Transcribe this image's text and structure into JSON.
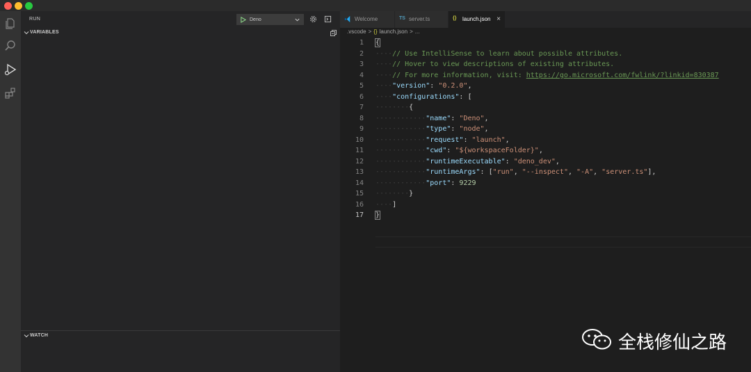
{
  "window": {
    "traffic_lights": [
      "close",
      "minimize",
      "maximize"
    ]
  },
  "activity_bar": {
    "icons": [
      "files-icon",
      "search-icon",
      "run-debug-icon",
      "extensions-icon"
    ]
  },
  "sidebar": {
    "title": "RUN",
    "config_select": "Deno",
    "variables_label": "VARIABLES",
    "watch_label": "WATCH"
  },
  "tabs": [
    {
      "label": "Welcome",
      "icon": "vscode-icon",
      "active": false
    },
    {
      "label": "server.ts",
      "icon_text": "TS",
      "active": false
    },
    {
      "label": "launch.json",
      "icon_text": "{}",
      "active": true,
      "close": "×"
    }
  ],
  "breadcrumb": {
    "folder": ".vscode",
    "sep": ">",
    "file_icon": "{}",
    "file": "launch.json",
    "more": "..."
  },
  "code": {
    "line_numbers": [
      "1",
      "2",
      "3",
      "4",
      "5",
      "6",
      "7",
      "8",
      "9",
      "10",
      "11",
      "12",
      "13",
      "14",
      "15",
      "16",
      "17"
    ],
    "lines": {
      "l1": "{",
      "l2": "// Use IntelliSense to learn about possible attributes.",
      "l3": "// Hover to view descriptions of existing attributes.",
      "l4_text": "// For more information, visit: ",
      "l4_link": "https://go.microsoft.com/fwlink/?linkid=830387",
      "l5_key": "\"version\"",
      "l5_val": "\"0.2.0\"",
      "l6_key": "\"configurations\"",
      "l6_rest": ": [",
      "l7": "{",
      "l8_key": "\"name\"",
      "l8_val": "\"Deno\"",
      "l9_key": "\"type\"",
      "l9_val": "\"node\"",
      "l10_key": "\"request\"",
      "l10_val": "\"launch\"",
      "l11_key": "\"cwd\"",
      "l11_val": "\"${workspaceFolder}\"",
      "l12_key": "\"runtimeExecutable\"",
      "l12_val": "\"deno_dev\"",
      "l13_key": "\"runtimeArgs\"",
      "l13_v1": "\"run\"",
      "l13_v2": "\"--inspect\"",
      "l13_v3": "\"-A\"",
      "l13_v4": "\"server.ts\"",
      "l14_key": "\"port\"",
      "l14_val": "9229",
      "l15": "}",
      "l16": "]",
      "l17": "}"
    }
  },
  "watermark": {
    "text": "全栈修仙之路",
    "icon": "wechat-icon"
  },
  "colors": {
    "comment": "#6a9955",
    "key": "#9cdcfe",
    "string": "#ce9178",
    "number": "#b5cea8"
  }
}
